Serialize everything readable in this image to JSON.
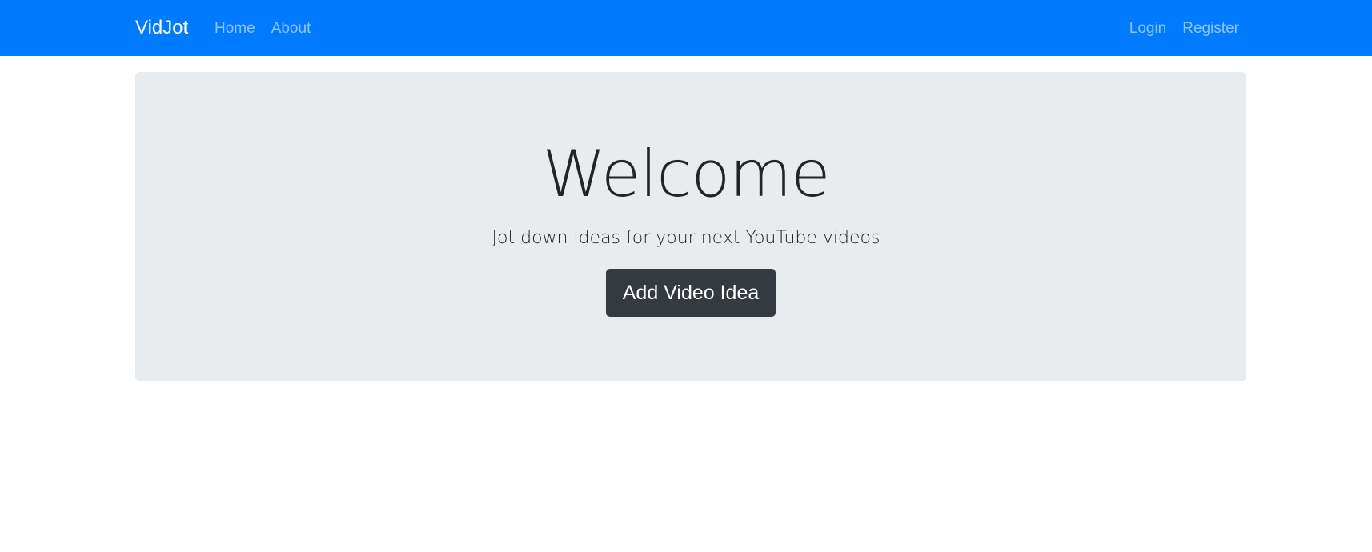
{
  "navbar": {
    "brand": "VidJot",
    "left_links": [
      {
        "label": "Home"
      },
      {
        "label": "About"
      }
    ],
    "right_links": [
      {
        "label": "Login"
      },
      {
        "label": "Register"
      }
    ]
  },
  "jumbotron": {
    "title": "Welcome",
    "lead": "Jot down ideas for your next YouTube videos",
    "button_label": "Add Video Idea"
  },
  "colors": {
    "navbar_bg": "#007bff",
    "jumbotron_bg": "#e9ecef",
    "button_bg": "#343a40"
  }
}
